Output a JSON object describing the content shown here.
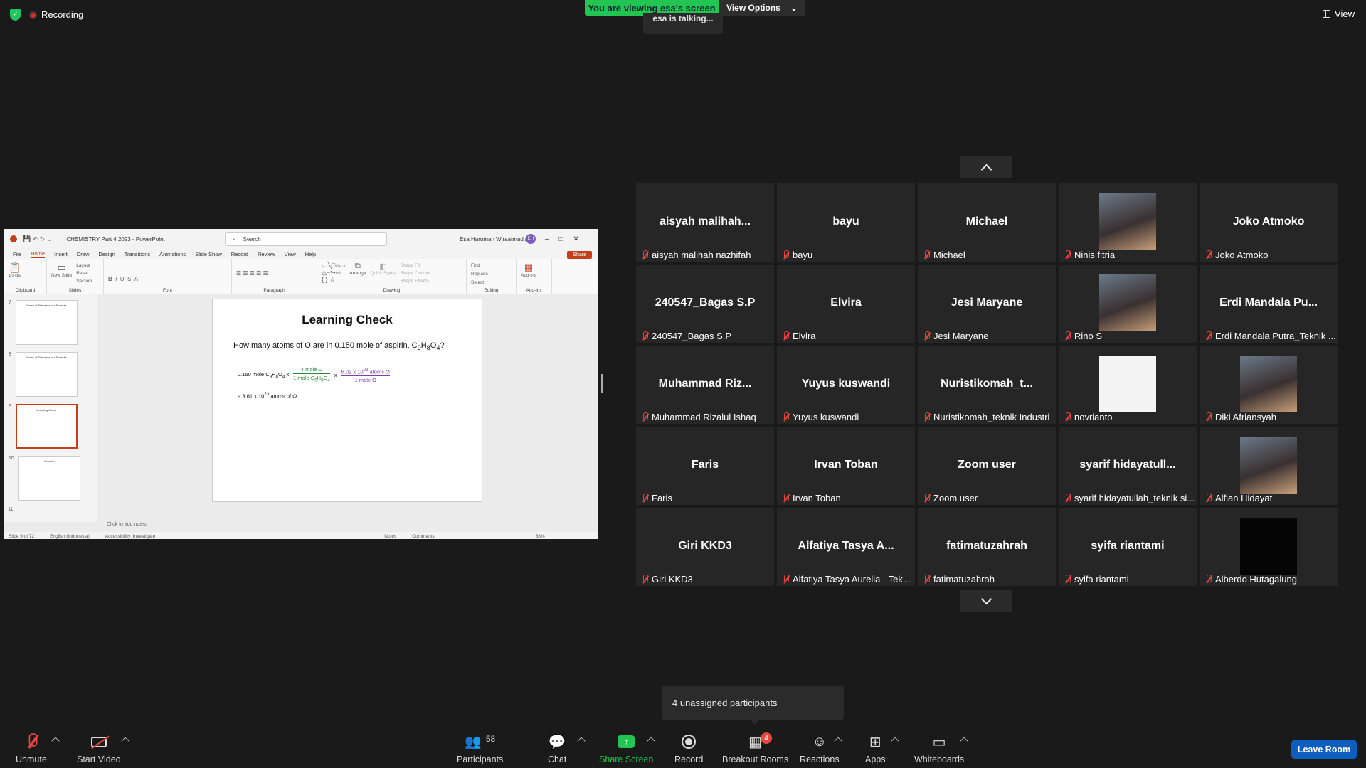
{
  "top": {
    "recording": "Recording",
    "viewing_banner": "You are viewing esa's screen",
    "view_options": "View Options",
    "talking": "esa is talking...",
    "view": "View"
  },
  "ppt": {
    "window_title": "CHEMISTRY Part 4 2023  -  PowerPoint",
    "search_placeholder": "Search",
    "user": "Esa Haruman Wiraatmadja",
    "user_initials": "EH",
    "menu": [
      "File",
      "Home",
      "Insert",
      "Draw",
      "Design",
      "Transitions",
      "Animations",
      "Slide Show",
      "Record",
      "Review",
      "View",
      "Help"
    ],
    "share": "Share",
    "groups": [
      "Clipboard",
      "Slides",
      "Font",
      "Paragraph",
      "Drawing",
      "Editing",
      "Add-ins"
    ],
    "ribbon": {
      "paste": "Paste",
      "new_slide": "New Slide",
      "layout": "Layout",
      "reset": "Reset",
      "section": "Section",
      "arrange": "Arrange",
      "quick_styles": "Quick Styles",
      "shape_fill": "Shape Fill",
      "shape_outline": "Shape Outline",
      "shape_effects": "Shape Effects",
      "find": "Find",
      "replace": "Replace",
      "select": "Select",
      "add_ins": "Add-ins"
    },
    "thumb_numbers": [
      "7",
      "8",
      "9",
      "10",
      "11"
    ],
    "thumb_titles": [
      "Moles of Elements in a Formula",
      "Moles of Elements in a Formula",
      "Learning Check",
      "Solution"
    ],
    "slide": {
      "title": "Learning Check",
      "question": "How many atoms of O are in 0.150 mole of aspirin, C",
      "formula_tail": "?",
      "calc_start": "0.150 mole C",
      "calc_factor1_num": "4 mole O",
      "calc_factor1_den": "1 mole C",
      "calc_factor2_num": "6.02 x 10",
      "calc_factor2_num_tail": " atoms O",
      "calc_factor2_den": "1 mole O",
      "answer": "=  3.61 x 10",
      "answer_tail": " atoms of O"
    },
    "notes_placeholder": "Click to add notes",
    "status": {
      "slide": "Slide 9 of 72",
      "language": "English (Indonesia)",
      "accessibility": "Accessibility: Investigate",
      "notes": "Notes",
      "comments": "Comments",
      "zoom": "68%"
    }
  },
  "participants": [
    {
      "big": "aisyah  malihah...",
      "cap": "aisyah malihah nazhifah"
    },
    {
      "big": "bayu",
      "cap": "bayu"
    },
    {
      "big": "Michael",
      "cap": "Michael"
    },
    {
      "big": "",
      "cap": "Ninis fitria",
      "photo": "person-photo"
    },
    {
      "big": "Joko Atmoko",
      "cap": "Joko Atmoko"
    },
    {
      "big": "240547_Bagas S.P",
      "cap": "240547_Bagas S.P"
    },
    {
      "big": "Elvira",
      "cap": "Elvira"
    },
    {
      "big": "Jesi Maryane",
      "cap": "Jesi Maryane"
    },
    {
      "big": "",
      "cap": "Rino S",
      "photo": "person-photo"
    },
    {
      "big": "Erdi  Mandala  Pu...",
      "cap": "Erdi Mandala Putra_Teknik ..."
    },
    {
      "big": "Muhammad  Riz...",
      "cap": "Muhammad Rizalul Ishaq"
    },
    {
      "big": "Yuyus kuswandi",
      "cap": "Yuyus kuswandi"
    },
    {
      "big": "Nuristikomah_t...",
      "cap": "Nuristikomah_teknik Industri"
    },
    {
      "big": "",
      "cap": "novrianto",
      "photo": "blank-photo"
    },
    {
      "big": "",
      "cap": "Diki Afriansyah",
      "photo": "person-photo"
    },
    {
      "big": "Faris",
      "cap": "Faris"
    },
    {
      "big": "Irvan Toban",
      "cap": "Irvan Toban"
    },
    {
      "big": "Zoom user",
      "cap": "Zoom user"
    },
    {
      "big": "syarif  hidayatull...",
      "cap": "syarif hidayatullah_teknik si..."
    },
    {
      "big": "",
      "cap": "Alfian Hidayat",
      "photo": "person-photo"
    },
    {
      "big": "Giri KKD3",
      "cap": "Giri KKD3"
    },
    {
      "big": "Alfatiya Tasya A...",
      "cap": "Alfatiya Tasya Aurelia - Tek..."
    },
    {
      "big": "fatimatuzahrah",
      "cap": "fatimatuzahrah"
    },
    {
      "big": "syifa riantami",
      "cap": "syifa riantami"
    },
    {
      "big": "",
      "cap": "Alberdo Hutagalung",
      "photo": "dark-photo"
    }
  ],
  "unassigned": "4 unassigned participants",
  "toolbar": {
    "unmute": "Unmute",
    "start_video": "Start Video",
    "participants": "Participants",
    "participants_count": "58",
    "chat": "Chat",
    "share_screen": "Share Screen",
    "record": "Record",
    "breakout": "Breakout Rooms",
    "breakout_badge": "4",
    "reactions": "Reactions",
    "apps": "Apps",
    "whiteboards": "Whiteboards",
    "leave": "Leave Room"
  },
  "colors": {
    "share_green": "#23c552",
    "leave_blue": "#0e5ebf",
    "mute_red": "#e5473f",
    "ppt_accent": "#c43e1c"
  }
}
